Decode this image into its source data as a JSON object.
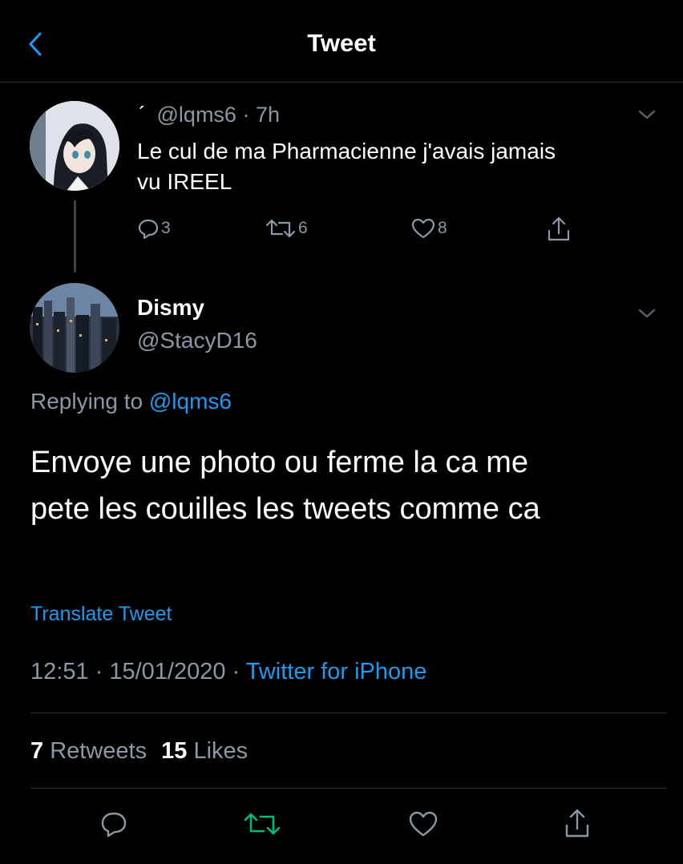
{
  "header": {
    "title": "Tweet",
    "back_icon": "chevron-left-icon"
  },
  "parent_tweet": {
    "name": "´",
    "handle": "@lqms6",
    "time": "· 7h",
    "text_line1": "Le cul de ma Pharmacienne j'avais jamais",
    "text_line2": "vu IREEL",
    "replies": "3",
    "retweets": "6",
    "likes": "8"
  },
  "main_tweet": {
    "name": "Dismy",
    "handle": "@StacyD16",
    "replying_prefix": "Replying to",
    "replying_handle": "@lqms6",
    "text_line1": "Envoye une photo ou ferme la ca me",
    "text_line2": "pete les couilles les tweets comme ca",
    "translate": "Translate Tweet",
    "timestamp": "12:51 · 15/01/2020 ·",
    "source": "Twitter for iPhone",
    "retweet_count": "7",
    "retweet_label": "Retweets",
    "like_count": "15",
    "like_label": "Likes"
  },
  "colors": {
    "accent": "#1d9bf0",
    "retweet": "#00ba7c",
    "background": "#000000"
  }
}
